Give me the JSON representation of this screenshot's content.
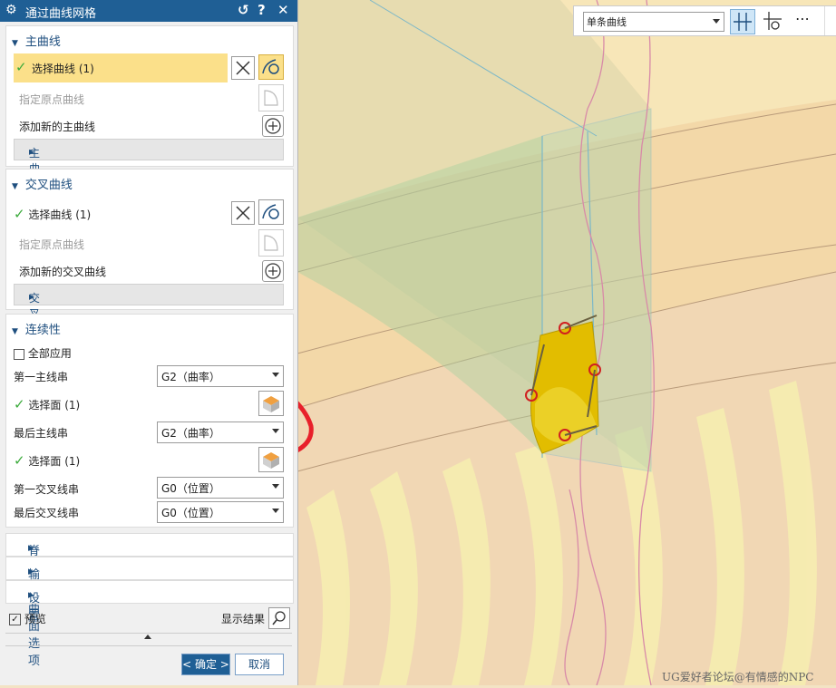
{
  "dialog": {
    "title": "通过曲线网格",
    "reset_icon": "reset-icon",
    "help_label": "?",
    "close_label": "✕"
  },
  "main_curves": {
    "header": "主曲线",
    "select_label": "选择曲线 (1)",
    "origin_label": "指定原点曲线",
    "add_label": "添加新的主曲线",
    "list_label": "主曲线列表"
  },
  "cross_curves": {
    "header": "交叉曲线",
    "select_label": "选择曲线 (1)",
    "origin_label": "指定原点曲线",
    "add_label": "添加新的交叉曲线",
    "list_label": "交叉曲线列表"
  },
  "continuity": {
    "header": "连续性",
    "apply_all_label": "全部应用",
    "first_primary_label": "第一主线串",
    "first_primary_value": "G2（曲率）",
    "select_face_1_label": "选择面 (1)",
    "last_primary_label": "最后主线串",
    "last_primary_value": "G2（曲率）",
    "select_face_2_label": "选择面 (1)",
    "first_cross_label": "第一交叉线串",
    "first_cross_value": "G0（位置）",
    "last_cross_label": "最后交叉线串",
    "last_cross_value": "G0（位置）"
  },
  "collapsed_sections": {
    "spine": "脊线",
    "output_options": "输出曲面选项",
    "settings": "设置"
  },
  "footer": {
    "preview_label": "预览",
    "show_result_label": "显示结果",
    "ok_label": "< 确定 >",
    "cancel_label": "取消"
  },
  "toolbar": {
    "select_filter_value": "单条曲线",
    "more_label": "⋯"
  },
  "watermark": "UG爱好者论坛@有情感的NPC",
  "colors": {
    "title_bar": "#1f5f95",
    "selection_highlight": "#fbe08a",
    "check": "#3cab3c",
    "annotation": "#e8202a",
    "surface": "#e2bd00"
  }
}
